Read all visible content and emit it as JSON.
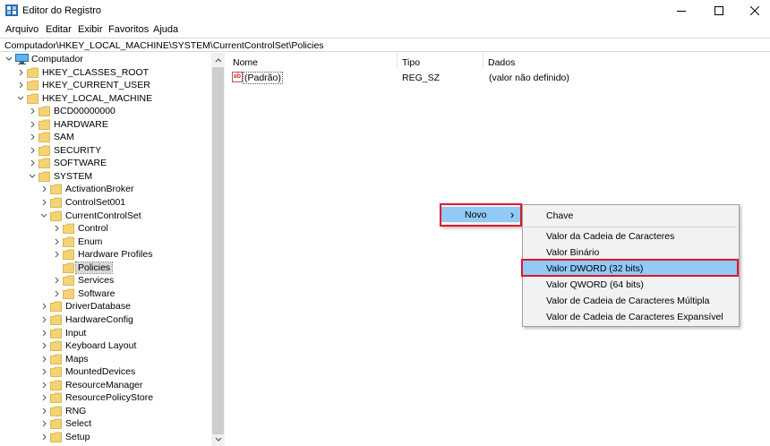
{
  "window": {
    "title": "Editor do Registro",
    "app_icon": "regedit-icon"
  },
  "menu": [
    "Arquivo",
    "Editar",
    "Exibir",
    "Favoritos",
    "Ajuda"
  ],
  "address": "Computador\\HKEY_LOCAL_MACHINE\\SYSTEM\\CurrentControlSet\\Policies",
  "tree": {
    "root": "Computador",
    "items": [
      {
        "label": "HKEY_CLASSES_ROOT",
        "depth": 1,
        "expanded": false
      },
      {
        "label": "HKEY_CURRENT_USER",
        "depth": 1,
        "expanded": false
      },
      {
        "label": "HKEY_LOCAL_MACHINE",
        "depth": 1,
        "expanded": true
      },
      {
        "label": "BCD00000000",
        "depth": 2,
        "expanded": false
      },
      {
        "label": "HARDWARE",
        "depth": 2,
        "expanded": false
      },
      {
        "label": "SAM",
        "depth": 2,
        "expanded": false
      },
      {
        "label": "SECURITY",
        "depth": 2,
        "expanded": false
      },
      {
        "label": "SOFTWARE",
        "depth": 2,
        "expanded": false
      },
      {
        "label": "SYSTEM",
        "depth": 2,
        "expanded": true
      },
      {
        "label": "ActivationBroker",
        "depth": 3,
        "expanded": false
      },
      {
        "label": "ControlSet001",
        "depth": 3,
        "expanded": false
      },
      {
        "label": "CurrentControlSet",
        "depth": 3,
        "expanded": true
      },
      {
        "label": "Control",
        "depth": 4,
        "expanded": false
      },
      {
        "label": "Enum",
        "depth": 4,
        "expanded": false
      },
      {
        "label": "Hardware Profiles",
        "depth": 4,
        "expanded": false
      },
      {
        "label": "Policies",
        "depth": 4,
        "selected": true,
        "leaf": true
      },
      {
        "label": "Services",
        "depth": 4,
        "expanded": false
      },
      {
        "label": "Software",
        "depth": 4,
        "expanded": false
      },
      {
        "label": "DriverDatabase",
        "depth": 3,
        "expanded": false
      },
      {
        "label": "HardwareConfig",
        "depth": 3,
        "expanded": false
      },
      {
        "label": "Input",
        "depth": 3,
        "expanded": false
      },
      {
        "label": "Keyboard Layout",
        "depth": 3,
        "expanded": false
      },
      {
        "label": "Maps",
        "depth": 3,
        "expanded": false
      },
      {
        "label": "MountedDevices",
        "depth": 3,
        "expanded": false
      },
      {
        "label": "ResourceManager",
        "depth": 3,
        "expanded": false
      },
      {
        "label": "ResourcePolicyStore",
        "depth": 3,
        "expanded": false
      },
      {
        "label": "RNG",
        "depth": 3,
        "expanded": false
      },
      {
        "label": "Select",
        "depth": 3,
        "expanded": false
      },
      {
        "label": "Setup",
        "depth": 3,
        "expanded": false
      }
    ]
  },
  "list": {
    "columns": [
      "Nome",
      "Tipo",
      "Dados"
    ],
    "rows": [
      {
        "name": "(Padrão)",
        "type": "REG_SZ",
        "data": "(valor não definido)"
      }
    ]
  },
  "context_menu": {
    "novo_label": "Novo",
    "submenu_arrow": "›",
    "submenu": [
      "Chave",
      "Valor da Cadeia de Caracteres",
      "Valor Binário",
      "Valor DWORD (32 bits)",
      "Valor QWORD (64 bits)",
      "Valor de Cadeia de Caracteres Múltipla",
      "Valor de Cadeia de Caracteres Expansível"
    ]
  },
  "colors": {
    "highlight": "#91c9f7",
    "annotation_red": "#e0182a",
    "folder_yellow": "#f3d373"
  }
}
